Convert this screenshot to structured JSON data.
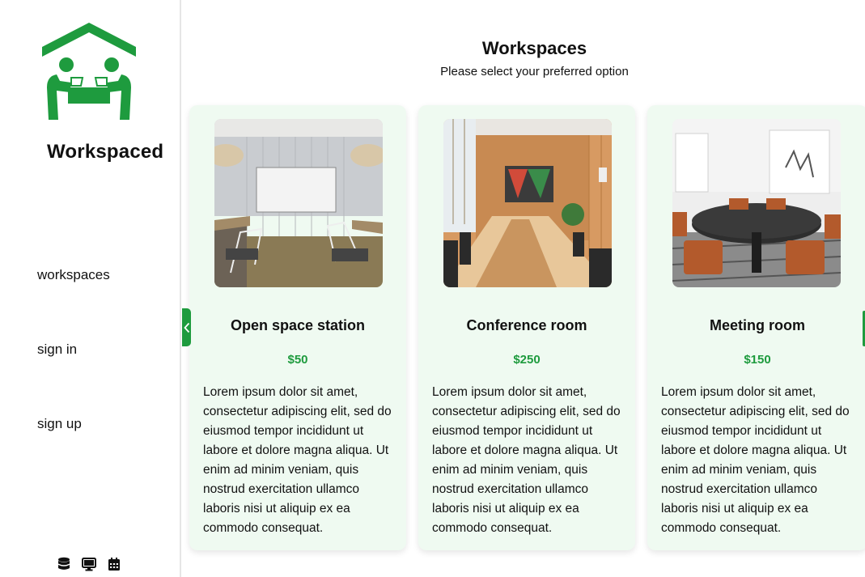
{
  "brand": {
    "name": "Workspaced",
    "logo_icon": "house-with-people-at-desk-icon",
    "accent_color": "#1e9b3e"
  },
  "nav": {
    "items": [
      {
        "label": "workspaces"
      },
      {
        "label": "sign in"
      },
      {
        "label": "sign up"
      }
    ]
  },
  "footer_icons": [
    "database-icon",
    "monitor-icon",
    "calendar-icon"
  ],
  "header": {
    "title": "Workspaces",
    "subtitle": "Please select your preferred option"
  },
  "carousel": {
    "prev_icon": "chevron-left-icon",
    "next_icon": "chevron-right-icon"
  },
  "cards": [
    {
      "title": "Open space station",
      "price": "$50",
      "description": "Lorem ipsum dolor sit amet, consectetur adipiscing elit, sed do eiusmod tempor incididunt ut labore et dolore magna aliqua. Ut enim ad minim veniam, quis nostrud exercitation ullamco laboris nisi ut aliquip ex ea commodo consequat."
    },
    {
      "title": "Conference room",
      "price": "$250",
      "description": "Lorem ipsum dolor sit amet, consectetur adipiscing elit, sed do eiusmod tempor incididunt ut labore et dolore magna aliqua. Ut enim ad minim veniam, quis nostrud exercitation ullamco laboris nisi ut aliquip ex ea commodo consequat."
    },
    {
      "title": "Meeting room",
      "price": "$150",
      "description": "Lorem ipsum dolor sit amet, consectetur adipiscing elit, sed do eiusmod tempor incididunt ut labore et dolore magna aliqua. Ut enim ad minim veniam, quis nostrud exercitation ullamco laboris nisi ut aliquip ex ea commodo consequat."
    }
  ]
}
